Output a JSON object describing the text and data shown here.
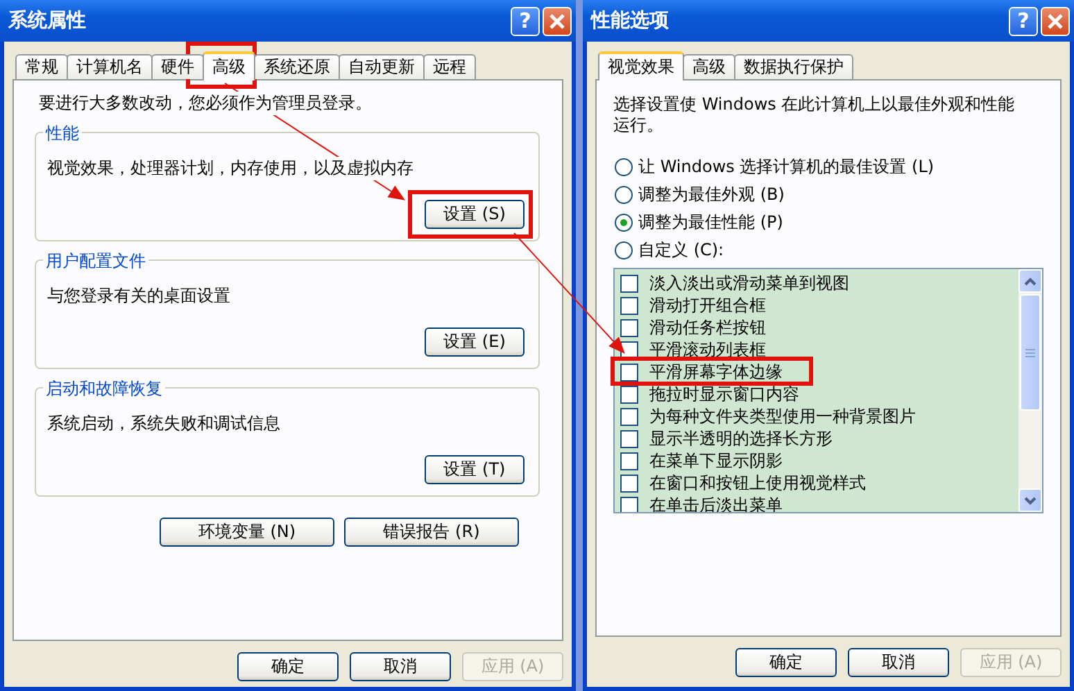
{
  "annotation_arrows": true,
  "system_properties": {
    "title": "系统属性",
    "help": "?",
    "tabs": [
      {
        "label": "常规",
        "selected": false,
        "highlighted": false
      },
      {
        "label": "计算机名",
        "selected": false,
        "highlighted": false
      },
      {
        "label": "硬件",
        "selected": false,
        "highlighted": false
      },
      {
        "label": "高级",
        "selected": true,
        "highlighted": true
      },
      {
        "label": "系统还原",
        "selected": false,
        "highlighted": false
      },
      {
        "label": "自动更新",
        "selected": false,
        "highlighted": false
      },
      {
        "label": "远程",
        "selected": false,
        "highlighted": false
      }
    ],
    "notice": "要进行大多数改动，您必须作为管理员登录。",
    "groups": [
      {
        "title": "性能",
        "description": "视觉效果，处理器计划，内存使用，以及虚拟内存",
        "button": {
          "label": "设置 (S)",
          "highlighted": true
        }
      },
      {
        "title": "用户配置文件",
        "description": "与您登录有关的桌面设置",
        "button": {
          "label": "设置 (E)",
          "highlighted": false
        }
      },
      {
        "title": "启动和故障恢复",
        "description": "系统启动，系统失败和调试信息",
        "button": {
          "label": "设置 (T)",
          "highlighted": false
        }
      }
    ],
    "extra_buttons": [
      {
        "label": "环境变量 (N)"
      },
      {
        "label": "错误报告 (R)"
      }
    ],
    "buttons": [
      {
        "label": "确定",
        "disabled": false
      },
      {
        "label": "取消",
        "disabled": false
      },
      {
        "label": "应用 (A)",
        "disabled": true
      }
    ]
  },
  "performance_options": {
    "title": "性能选项",
    "help": "?",
    "tabs": [
      {
        "label": "视觉效果",
        "selected": true
      },
      {
        "label": "高级",
        "selected": false
      },
      {
        "label": "数据执行保护",
        "selected": false
      }
    ],
    "description": "选择设置使 Windows 在此计算机上以最佳外观和性能运行。",
    "options": [
      {
        "label": "让 Windows 选择计算机的最佳设置 (L)",
        "selected": false
      },
      {
        "label": "调整为最佳外观 (B)",
        "selected": false
      },
      {
        "label": "调整为最佳性能 (P)",
        "selected": true
      },
      {
        "label": "自定义 (C):",
        "selected": false
      }
    ],
    "effects": [
      {
        "label": "淡入淡出或滑动菜单到视图",
        "checked": false,
        "highlighted": false
      },
      {
        "label": "滑动打开组合框",
        "checked": false,
        "highlighted": false
      },
      {
        "label": "滑动任务栏按钮",
        "checked": false,
        "highlighted": false
      },
      {
        "label": "平滑滚动列表框",
        "checked": false,
        "highlighted": false
      },
      {
        "label": "平滑屏幕字体边缘",
        "checked": false,
        "highlighted": true
      },
      {
        "label": "拖拉时显示窗口内容",
        "checked": false,
        "highlighted": false
      },
      {
        "label": "为每种文件夹类型使用一种背景图片",
        "checked": false,
        "highlighted": false
      },
      {
        "label": "显示半透明的选择长方形",
        "checked": false,
        "highlighted": false
      },
      {
        "label": "在菜单下显示阴影",
        "checked": false,
        "highlighted": false
      },
      {
        "label": "在窗口和按钮上使用视觉样式",
        "checked": false,
        "highlighted": false
      },
      {
        "label": "在单击后淡出菜单",
        "checked": false,
        "highlighted": false
      }
    ],
    "buttons": [
      {
        "label": "确定",
        "disabled": false
      },
      {
        "label": "取消",
        "disabled": false
      },
      {
        "label": "应用 (A)",
        "disabled": true
      }
    ]
  }
}
